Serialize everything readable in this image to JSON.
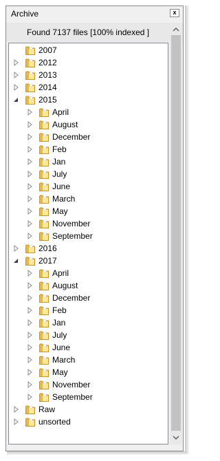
{
  "window": {
    "title": "Archive",
    "close_label": "x"
  },
  "status": {
    "text": "Found  7137 files [100% indexed ]"
  },
  "tree": [
    {
      "label": "2007",
      "level": 0,
      "state": "none"
    },
    {
      "label": "2012",
      "level": 0,
      "state": "collapsed"
    },
    {
      "label": "2013",
      "level": 0,
      "state": "collapsed"
    },
    {
      "label": "2014",
      "level": 0,
      "state": "collapsed"
    },
    {
      "label": "2015",
      "level": 0,
      "state": "expanded"
    },
    {
      "label": "April",
      "level": 1,
      "state": "collapsed"
    },
    {
      "label": "August",
      "level": 1,
      "state": "collapsed"
    },
    {
      "label": "December",
      "level": 1,
      "state": "collapsed"
    },
    {
      "label": "Feb",
      "level": 1,
      "state": "collapsed"
    },
    {
      "label": "Jan",
      "level": 1,
      "state": "collapsed"
    },
    {
      "label": "July",
      "level": 1,
      "state": "collapsed"
    },
    {
      "label": "June",
      "level": 1,
      "state": "collapsed"
    },
    {
      "label": "March",
      "level": 1,
      "state": "collapsed"
    },
    {
      "label": "May",
      "level": 1,
      "state": "collapsed"
    },
    {
      "label": "November",
      "level": 1,
      "state": "collapsed"
    },
    {
      "label": "September",
      "level": 1,
      "state": "collapsed"
    },
    {
      "label": "2016",
      "level": 0,
      "state": "collapsed"
    },
    {
      "label": "2017",
      "level": 0,
      "state": "expanded"
    },
    {
      "label": "April",
      "level": 1,
      "state": "collapsed"
    },
    {
      "label": "August",
      "level": 1,
      "state": "collapsed"
    },
    {
      "label": "December",
      "level": 1,
      "state": "collapsed"
    },
    {
      "label": "Feb",
      "level": 1,
      "state": "collapsed"
    },
    {
      "label": "Jan",
      "level": 1,
      "state": "collapsed"
    },
    {
      "label": "July",
      "level": 1,
      "state": "collapsed"
    },
    {
      "label": "June",
      "level": 1,
      "state": "collapsed"
    },
    {
      "label": "March",
      "level": 1,
      "state": "collapsed"
    },
    {
      "label": "May",
      "level": 1,
      "state": "collapsed"
    },
    {
      "label": "November",
      "level": 1,
      "state": "collapsed"
    },
    {
      "label": "September",
      "level": 1,
      "state": "collapsed"
    },
    {
      "label": "Raw",
      "level": 0,
      "state": "collapsed"
    },
    {
      "label": "unsorted",
      "level": 0,
      "state": "collapsed"
    }
  ],
  "icons": {
    "folder": "folder-icon",
    "collapsed": "expand-triangle-icon",
    "expanded": "collapse-triangle-icon"
  },
  "colors": {
    "folder_light": "#fde89a",
    "folder_dark": "#e7b84a",
    "folder_edge": "#c8962a"
  }
}
